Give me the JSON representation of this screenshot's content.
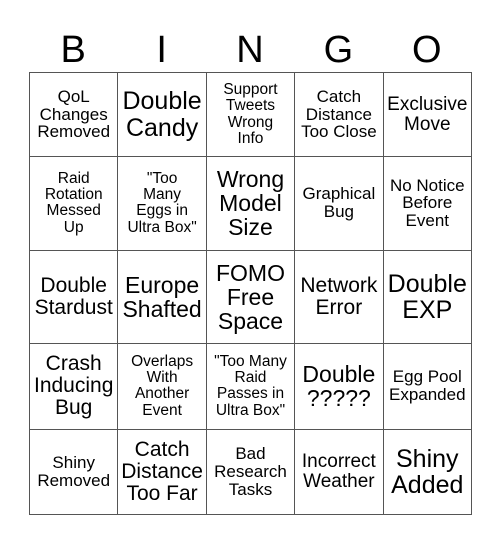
{
  "header": [
    "B",
    "I",
    "N",
    "G",
    "O"
  ],
  "cells": [
    [
      "QoL\nChanges\nRemoved",
      "Double\nCandy",
      "Support\nTweets\nWrong\nInfo",
      "Catch\nDistance\nToo Close",
      "Exclusive\nMove"
    ],
    [
      "Raid\nRotation\nMessed\nUp",
      "\"Too\nMany\nEggs in\nUltra Box\"",
      "Wrong\nModel\nSize",
      "Graphical\nBug",
      "No Notice\nBefore\nEvent"
    ],
    [
      "Double\nStardust",
      "Europe\nShafted",
      "FOMO\nFree\nSpace",
      "Network\nError",
      "Double\nEXP"
    ],
    [
      "Crash\nInducing\nBug",
      "Overlaps\nWith\nAnother\nEvent",
      "\"Too Many\nRaid\nPasses in\nUltra Box\"",
      "Double\n?????",
      "Egg Pool\nExpanded"
    ],
    [
      "Shiny\nRemoved",
      "Catch\nDistance\nToo Far",
      "Bad\nResearch\nTasks",
      "Incorrect\nWeather",
      "Shiny\nAdded"
    ]
  ]
}
